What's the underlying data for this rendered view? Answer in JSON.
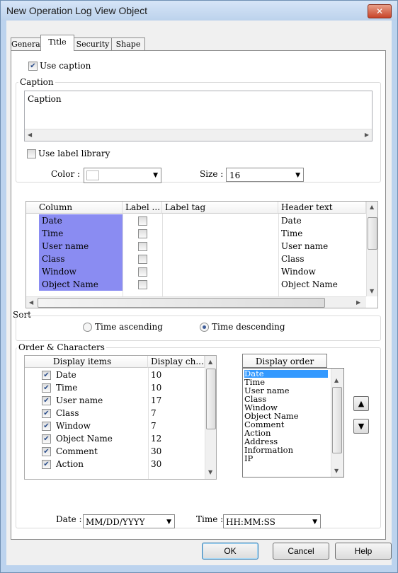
{
  "window": {
    "title": "New Operation Log View Object",
    "close_symbol": "✕"
  },
  "tabs": [
    "General",
    "Title",
    "Security",
    "Shape"
  ],
  "caption_section": {
    "use_caption_label": "Use caption",
    "use_caption_checked": true,
    "group_label": "Caption",
    "caption_text": "Caption",
    "use_label_library_label": "Use label library",
    "use_label_library_checked": false,
    "color_label": "Color :",
    "size_label": "Size :",
    "size_value": "16"
  },
  "column_grid": {
    "headers": [
      "Column",
      "Label ...",
      "Label tag",
      "Header text"
    ],
    "rows": [
      {
        "column": "Date",
        "header_text": "Date"
      },
      {
        "column": "Time",
        "header_text": "Time"
      },
      {
        "column": "User name",
        "header_text": "User name"
      },
      {
        "column": "Class",
        "header_text": "Class"
      },
      {
        "column": "Window",
        "header_text": "Window"
      },
      {
        "column": "Object Name",
        "header_text": "Object Name"
      }
    ]
  },
  "sort": {
    "group_label": "Sort",
    "ascending_label": "Time ascending",
    "descending_label": "Time descending",
    "selected": "descending"
  },
  "order": {
    "group_label": "Order & Characters",
    "headers": [
      "Display items",
      "Display ch..."
    ],
    "rows": [
      {
        "item": "Date",
        "chars": "10"
      },
      {
        "item": "Time",
        "chars": "10"
      },
      {
        "item": "User name",
        "chars": "17"
      },
      {
        "item": "Class",
        "chars": "7"
      },
      {
        "item": "Window",
        "chars": "7"
      },
      {
        "item": "Object Name",
        "chars": "12"
      },
      {
        "item": "Comment",
        "chars": "30"
      },
      {
        "item": "Action",
        "chars": "30"
      }
    ],
    "display_order_header": "Display order",
    "display_order_items": [
      "Date",
      "Time",
      "User name",
      "Class",
      "Window",
      "Object Name",
      "Comment",
      "Action",
      "Address",
      "Information",
      "IP"
    ],
    "up_symbol": "▲",
    "down_symbol": "▼"
  },
  "formats": {
    "date_label": "Date :",
    "date_value": "MM/DD/YYYY",
    "time_label": "Time :",
    "time_value": "HH:MM:SS"
  },
  "buttons": {
    "ok": "OK",
    "cancel": "Cancel",
    "help": "Help"
  },
  "colors": {
    "selection": "#8a8cf2",
    "list_selection": "#3399ff",
    "title_bar": "#bcd3ee"
  }
}
